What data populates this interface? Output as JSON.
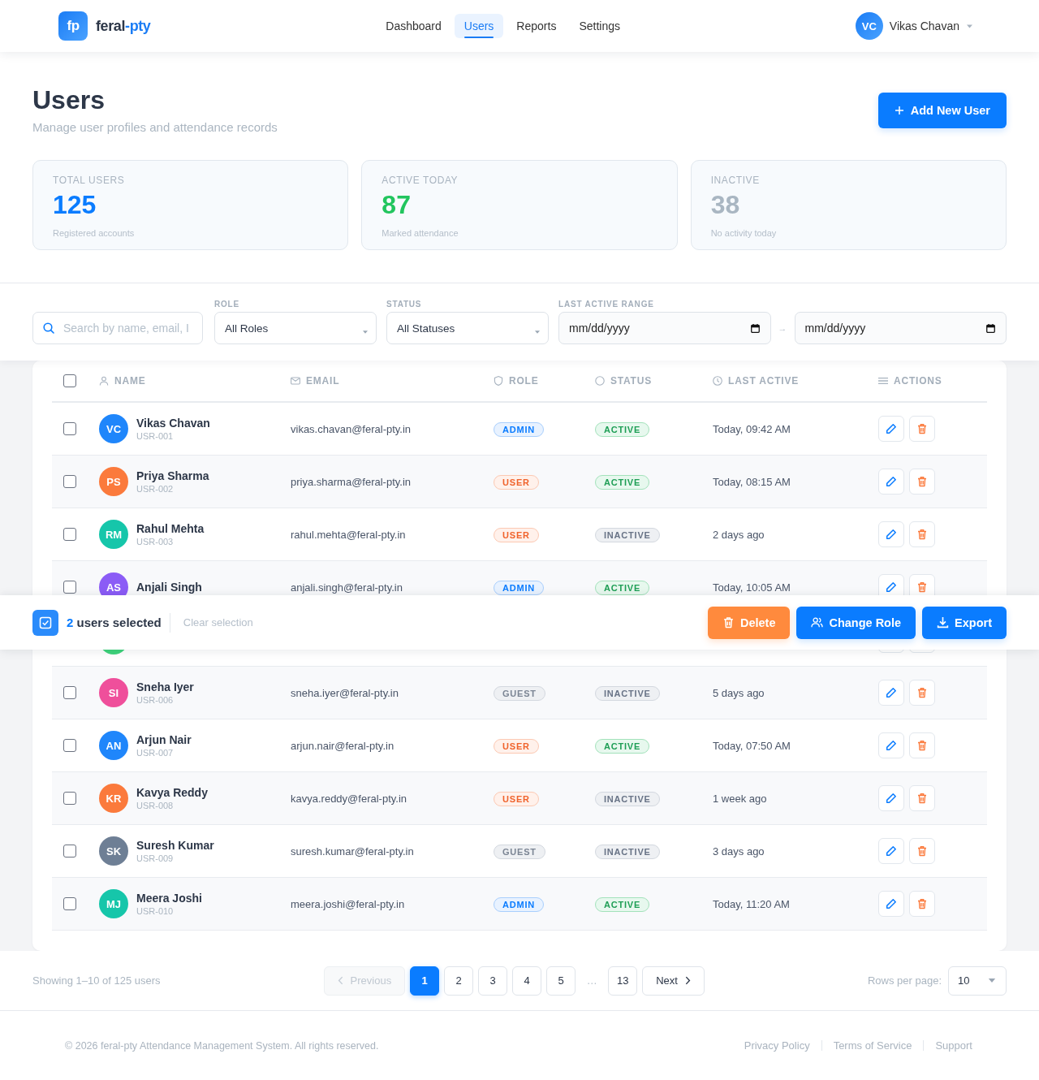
{
  "header": {
    "brand": {
      "mark": "fp",
      "name": "feral",
      "suffix": "-pty"
    },
    "nav": [
      {
        "label": "Dashboard",
        "selected": false
      },
      {
        "label": "Users",
        "selected": true
      },
      {
        "label": "Reports",
        "selected": false
      },
      {
        "label": "Settings",
        "selected": false
      }
    ],
    "user": {
      "initials": "VC",
      "name": "Vikas Chavan"
    }
  },
  "page": {
    "title": "Users",
    "subtitle": "Manage user profiles and attendance records",
    "add_button": "Add New User"
  },
  "stats": [
    {
      "label": "TOTAL USERS",
      "value": "125",
      "note": "Registered accounts",
      "color": "#0a7cff"
    },
    {
      "label": "ACTIVE TODAY",
      "value": "87",
      "note": "Marked attendance",
      "color": "#22c55e"
    },
    {
      "label": "INACTIVE",
      "value": "38",
      "note": "No activity today",
      "color": "#a9b6c2"
    }
  ],
  "filters": {
    "search": {
      "placeholder": "Search by name, email, I"
    },
    "role": {
      "label": "ROLE",
      "value": "All Roles"
    },
    "status": {
      "label": "STATUS",
      "value": "All Statuses"
    },
    "date_range": {
      "label": "LAST ACTIVE RANGE",
      "from": {
        "placeholder": "mm/dd/yyyy"
      },
      "separator": "→",
      "to": {
        "placeholder": "mm/dd/yyyy"
      }
    }
  },
  "table": {
    "select_all": {
      "checked": false
    },
    "columns": [
      {
        "label": "NAME",
        "kind": "name"
      },
      {
        "label": "EMAIL",
        "kind": "email"
      },
      {
        "label": "ROLE",
        "kind": "role"
      },
      {
        "label": "STATUS",
        "kind": "status"
      },
      {
        "label": "LAST ACTIVE",
        "kind": "last_active"
      },
      {
        "label": "ACTIONS",
        "kind": "actions"
      }
    ],
    "rows": [
      {
        "checked": false,
        "initials": "VC",
        "color": "#1f86fb",
        "name": "Vikas Chavan",
        "id": "USR-001",
        "email": "vikas.chavan@feral-pty.in",
        "role": {
          "label": "ADMIN",
          "kind": "admin"
        },
        "status": {
          "label": "ACTIVE",
          "active": true
        },
        "last_active": "Today, 09:42 AM"
      },
      {
        "checked": false,
        "initials": "PS",
        "color": "#fb7a3c",
        "name": "Priya Sharma",
        "id": "USR-002",
        "email": "priya.sharma@feral-pty.in",
        "role": {
          "label": "USER",
          "kind": "user"
        },
        "status": {
          "label": "ACTIVE",
          "active": true
        },
        "last_active": "Today, 08:15 AM"
      },
      {
        "checked": false,
        "initials": "RM",
        "color": "#16c6aa",
        "name": "Rahul Mehta",
        "id": "USR-003",
        "email": "rahul.mehta@feral-pty.in",
        "role": {
          "label": "USER",
          "kind": "user"
        },
        "status": {
          "label": "INACTIVE",
          "active": false
        },
        "last_active": "2 days ago"
      },
      {
        "checked": false,
        "initials": "AS",
        "color": "#8b5cf6",
        "name": "Anjali Singh",
        "email": "anjali.singh@feral-pty.in",
        "role": {
          "label": "ADMIN",
          "kind": "admin"
        },
        "status": {
          "label": "ACTIVE",
          "active": true
        },
        "last_active": "Today, 10:05 AM"
      },
      {
        "color": "#3fd47c"
      },
      {
        "checked": false,
        "initials": "SI",
        "color": "#ef4f9b",
        "name": "Sneha Iyer",
        "id": "USR-006",
        "email": "sneha.iyer@feral-pty.in",
        "role": {
          "label": "GUEST",
          "kind": "guest"
        },
        "status": {
          "label": "INACTIVE",
          "active": false
        },
        "last_active": "5 days ago"
      },
      {
        "checked": false,
        "initials": "AN",
        "color": "#1f86fb",
        "name": "Arjun Nair",
        "id": "USR-007",
        "email": "arjun.nair@feral-pty.in",
        "role": {
          "label": "USER",
          "kind": "user"
        },
        "status": {
          "label": "ACTIVE",
          "active": true
        },
        "last_active": "Today, 07:50 AM"
      },
      {
        "checked": false,
        "initials": "KR",
        "color": "#fb7a3c",
        "name": "Kavya Reddy",
        "id": "USR-008",
        "email": "kavya.reddy@feral-pty.in",
        "role": {
          "label": "USER",
          "kind": "user"
        },
        "status": {
          "label": "INACTIVE",
          "active": false
        },
        "last_active": "1 week ago"
      },
      {
        "checked": false,
        "initials": "SK",
        "color": "#6e7f95",
        "name": "Suresh Kumar",
        "id": "USR-009",
        "email": "suresh.kumar@feral-pty.in",
        "role": {
          "label": "GUEST",
          "kind": "guest"
        },
        "status": {
          "label": "INACTIVE",
          "active": false
        },
        "last_active": "3 days ago"
      },
      {
        "checked": false,
        "initials": "MJ",
        "color": "#16c6aa",
        "name": "Meera Joshi",
        "id": "USR-010",
        "email": "meera.joshi@feral-pty.in",
        "role": {
          "label": "ADMIN",
          "kind": "admin"
        },
        "status": {
          "label": "ACTIVE",
          "active": true
        },
        "last_active": "Today, 11:20 AM"
      }
    ]
  },
  "selection_bar": {
    "count": "2",
    "label": "users selected",
    "clear": "Clear selection",
    "actions": [
      {
        "label": "Delete",
        "kind": "delete"
      },
      {
        "label": "Change Role",
        "kind": "role"
      },
      {
        "label": "Export",
        "kind": "export"
      }
    ]
  },
  "pagination": {
    "summary": "Showing 1–10 of 125 users",
    "previous": {
      "label": "Previous",
      "disabled": true
    },
    "pages": [
      {
        "kind": "page",
        "label": "1",
        "selected": true
      },
      {
        "kind": "page",
        "label": "2",
        "selected": false
      },
      {
        "kind": "page",
        "label": "3",
        "selected": false
      },
      {
        "kind": "page",
        "label": "4",
        "selected": false
      },
      {
        "kind": "page",
        "label": "5",
        "selected": false
      },
      {
        "kind": "ellipsis",
        "label": "…"
      },
      {
        "kind": "page",
        "label": "13",
        "selected": false
      }
    ],
    "next": {
      "label": "Next",
      "disabled": false
    },
    "rows_per_page": {
      "label": "Rows per page:",
      "value": "10"
    }
  },
  "footer": {
    "copyright": "© 2026 feral-pty Attendance Management System. All rights reserved.",
    "links": [
      "Privacy Policy",
      "Terms of Service",
      "Support"
    ]
  }
}
